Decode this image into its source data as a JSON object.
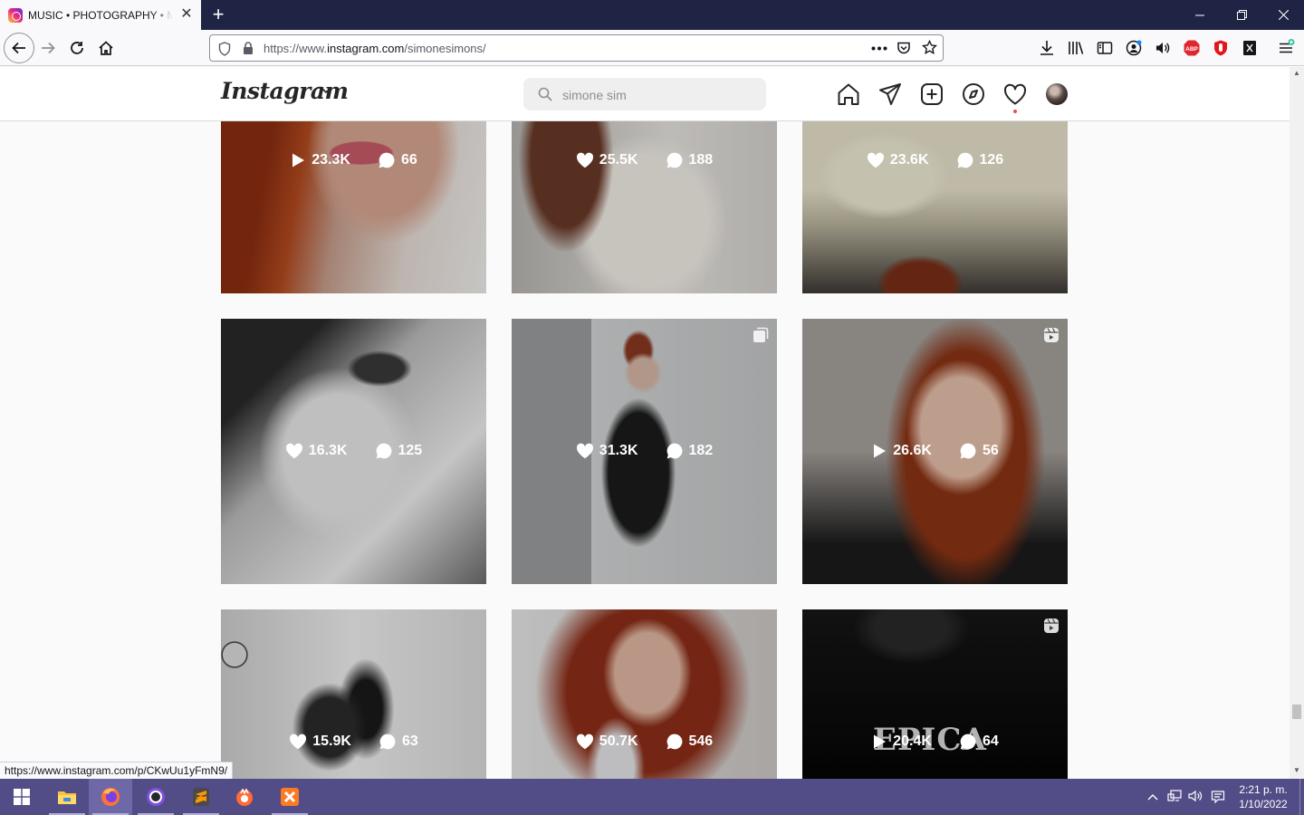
{
  "browser": {
    "tab_title": "MUSIC • PHOTOGRAPHY • MAKEUP",
    "new_tab": "+",
    "url_prefix": "https://www.",
    "url_domain": "instagram.com",
    "url_path": "/simonesimons/",
    "status_link": "https://www.instagram.com/p/CKwUu1yFmN9/"
  },
  "instagram": {
    "logo": "Instagram",
    "search_value": "simone sim",
    "nav_icons": [
      "home-icon",
      "direct-icon",
      "new-post-icon",
      "explore-icon",
      "activity-icon",
      "profile-avatar"
    ]
  },
  "posts": [
    {
      "type": "video",
      "likes": "23.3K",
      "comments": "66",
      "corner": ""
    },
    {
      "type": "photo",
      "likes": "25.5K",
      "comments": "188",
      "corner": ""
    },
    {
      "type": "photo",
      "likes": "23.6K",
      "comments": "126",
      "corner": ""
    },
    {
      "type": "photo",
      "likes": "16.3K",
      "comments": "125",
      "corner": ""
    },
    {
      "type": "photo",
      "likes": "31.3K",
      "comments": "182",
      "corner": "carousel-icon"
    },
    {
      "type": "video",
      "likes": "26.6K",
      "comments": "56",
      "corner": "reels-icon"
    },
    {
      "type": "photo",
      "likes": "15.9K",
      "comments": "63",
      "corner": ""
    },
    {
      "type": "photo",
      "likes": "50.7K",
      "comments": "546",
      "corner": ""
    },
    {
      "type": "video",
      "likes": "20.4K",
      "comments": "64",
      "corner": "reels-icon",
      "overlay_text": "EPICA"
    }
  ],
  "taskbar": {
    "clock_time": "2:21 p. m.",
    "clock_date": "1/10/2022",
    "apps": [
      "windows-start",
      "file-explorer",
      "firefox",
      "github-desktop",
      "sublime-text",
      "postman",
      "xampp"
    ]
  }
}
